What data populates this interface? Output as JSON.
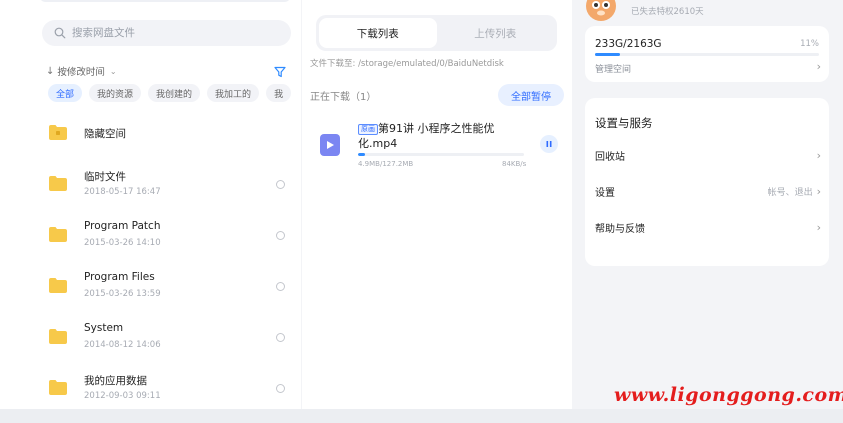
{
  "colors": {
    "accent": "#2f6bff",
    "progress": "#2f8bff",
    "folder": "#f7c94a",
    "watermark": "#e41d1d"
  },
  "files": {
    "search_placeholder": "搜索网盘文件",
    "sort_label": "按修改时间",
    "chips": [
      "全部",
      "我的资源",
      "我创建的",
      "我加工的",
      "我"
    ],
    "items": [
      {
        "name": "隐藏空间",
        "date": "",
        "icon": "locked-folder-icon"
      },
      {
        "name": "临时文件",
        "date": "2018-05-17  16:47",
        "icon": "folder-icon"
      },
      {
        "name": "Program Patch",
        "date": "2015-03-26  14:10",
        "icon": "folder-icon"
      },
      {
        "name": "Program Files",
        "date": "2015-03-26  13:59",
        "icon": "folder-icon"
      },
      {
        "name": "System",
        "date": "2014-08-12  14:06",
        "icon": "folder-icon"
      },
      {
        "name": "我的应用数据",
        "date": "2012-09-03  09:11",
        "icon": "folder-icon"
      }
    ]
  },
  "transfer": {
    "tabs": [
      "下载列表",
      "上传列表"
    ],
    "path": "文件下载至: /storage/emulated/0/BaiduNetdisk",
    "downloading_label": "正在下载（1）",
    "pause_all": "全部暂停",
    "task": {
      "tag": "原画",
      "name": "第91讲  小程序之性能优化.mp4",
      "size": "4.9MB/127.2MB",
      "speed": "84KB/s",
      "progress": 0.04
    }
  },
  "account": {
    "vip_days": "已失去特权2610天",
    "storage_used": "233G/2163G",
    "storage_percent": "11%",
    "storage_fraction": 0.11,
    "manage_label": "管理空间"
  },
  "settings": {
    "title": "设置与服务",
    "items": [
      {
        "label": "回收站",
        "hint": ""
      },
      {
        "label": "设置",
        "hint": "帐号、退出"
      },
      {
        "label": "帮助与反馈",
        "hint": ""
      }
    ]
  },
  "watermark": "www.ligonggong.com"
}
